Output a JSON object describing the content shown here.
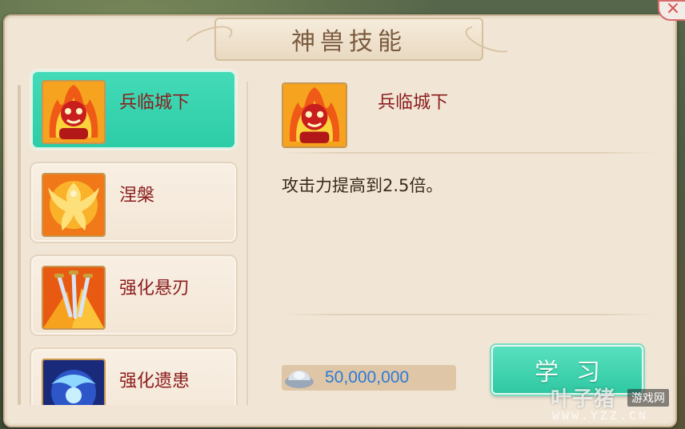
{
  "dialog": {
    "title": "神兽技能",
    "close_label": "×"
  },
  "skills": [
    {
      "label": "兵临城下",
      "icon": "fire-demon-icon",
      "selected": true
    },
    {
      "label": "涅槃",
      "icon": "phoenix-icon",
      "selected": false
    },
    {
      "label": "强化悬刃",
      "icon": "flying-swords-icon",
      "selected": false
    },
    {
      "label": "强化遗患",
      "icon": "blue-spirit-icon",
      "selected": false
    }
  ],
  "detail": {
    "name": "兵临城下",
    "icon": "fire-demon-icon",
    "description": "攻击力提高到2.5倍。"
  },
  "cost": {
    "icon": "silver-ingot-icon",
    "value": "50,000,000"
  },
  "learn_button": {
    "label": "学习"
  },
  "watermark": {
    "brand": "叶子猪",
    "tag": "游戏网",
    "url": "WWW.YZZ.CN"
  },
  "colors": {
    "selected_item": "#2ccca6",
    "skill_name": "#8b1c1c",
    "cost_value": "#2e7ad8",
    "panel_bg": "#f1e6d6"
  }
}
